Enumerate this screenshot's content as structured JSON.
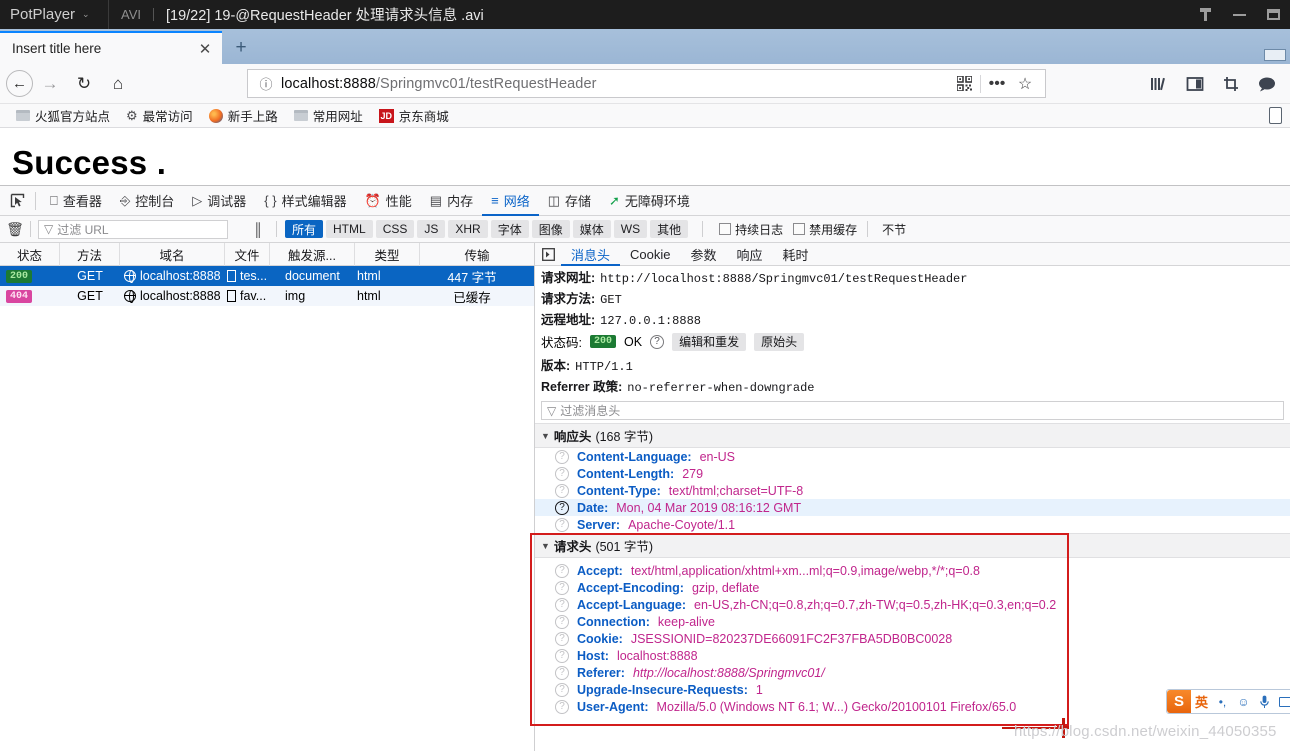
{
  "potplayer": {
    "app_name": "PotPlayer",
    "caret": "⌄",
    "format": "AVI",
    "title": "[19/22] 19-@RequestHeader 处理请求头信息 .avi",
    "pin_icon": "pin-icon",
    "minimize_icon": "minimize-icon",
    "maximize_icon": "maximize-icon"
  },
  "browser": {
    "tab_title": "Insert title here",
    "tab_close": "✕",
    "new_tab": "+",
    "nav": {
      "back": "←",
      "forward": "→",
      "reload": "↻",
      "home": "⌂"
    },
    "url": {
      "info_icon": "ⓘ",
      "full": "localhost:8888/Springmvc01/testRequestHeader",
      "host": "localhost:8888",
      "path": "/Springmvc01/testRequestHeader",
      "qr_icon": "qr-code-icon",
      "more_icon": "•••",
      "star_icon": "☆"
    },
    "toolbar_icons": [
      "library-icon",
      "sidebar-icon",
      "screenshot-icon",
      "pocket-icon"
    ],
    "bookmarks": [
      {
        "label": "火狐官方站点",
        "icon": "folder-icon"
      },
      {
        "label": "最常访问",
        "icon": "gear-icon"
      },
      {
        "label": "新手上路",
        "icon": "firefox-icon"
      },
      {
        "label": "常用网址",
        "icon": "folder-icon"
      },
      {
        "label": "京东商城",
        "icon": "jd-icon"
      }
    ]
  },
  "page": {
    "heading": "Success ."
  },
  "devtools": {
    "picker_icon": "element-picker-icon",
    "tabs": [
      {
        "label": "查看器",
        "icon": "inspector-icon",
        "active": false
      },
      {
        "label": "控制台",
        "icon": "console-icon",
        "active": false
      },
      {
        "label": "调试器",
        "icon": "debugger-icon",
        "active": false
      },
      {
        "label": "样式编辑器",
        "icon": "style-editor-icon",
        "active": false
      },
      {
        "label": "性能",
        "icon": "performance-icon",
        "active": false
      },
      {
        "label": "内存",
        "icon": "memory-icon",
        "active": false
      },
      {
        "label": "网络",
        "icon": "network-icon",
        "active": true
      },
      {
        "label": "存储",
        "icon": "storage-icon",
        "active": false
      },
      {
        "label": "无障碍环境",
        "icon": "accessibility-icon",
        "active": false
      }
    ],
    "toolbar": {
      "trash_icon": "trash-icon",
      "filter_placeholder": "过滤 URL",
      "filter_icon": "funnel-icon",
      "pause_icon": "pause-icon",
      "type_filters": [
        {
          "label": "所有",
          "active": true
        },
        {
          "label": "HTML",
          "active": false
        },
        {
          "label": "CSS",
          "active": false
        },
        {
          "label": "JS",
          "active": false
        },
        {
          "label": "XHR",
          "active": false
        },
        {
          "label": "字体",
          "active": false
        },
        {
          "label": "图像",
          "active": false
        },
        {
          "label": "媒体",
          "active": false
        },
        {
          "label": "WS",
          "active": false
        },
        {
          "label": "其他",
          "active": false
        }
      ],
      "checkboxes": [
        {
          "label": "持续日志",
          "checked": false
        },
        {
          "label": "禁用缓存",
          "checked": false
        }
      ],
      "trailing_label": "不节"
    },
    "request_list": {
      "columns": [
        "状态",
        "方法",
        "域名",
        "文件",
        "触发源...",
        "类型",
        "传输"
      ],
      "rows": [
        {
          "status": "200",
          "method": "GET",
          "domain": "localhost:8888",
          "file": "tes...",
          "cause": "document",
          "type": "html",
          "transferred": "447 字节",
          "selected": true,
          "file_icon": "document-icon"
        },
        {
          "status": "404",
          "method": "GET",
          "domain": "localhost:8888",
          "file": "fav...",
          "cause": "img",
          "type": "html",
          "transferred": "已缓存",
          "selected": false,
          "file_icon": "file-icon"
        }
      ]
    },
    "detail": {
      "toggle_icon": "panel-toggle-icon",
      "tabs": [
        {
          "label": "消息头",
          "active": true
        },
        {
          "label": "Cookie",
          "active": false
        },
        {
          "label": "参数",
          "active": false
        },
        {
          "label": "响应",
          "active": false
        },
        {
          "label": "耗时",
          "active": false
        }
      ],
      "summary": [
        {
          "key": "请求网址:",
          "value": "http://localhost:8888/Springmvc01/testRequestHeader"
        },
        {
          "key": "请求方法:",
          "value": "GET"
        },
        {
          "key": "远程地址:",
          "value": "127.0.0.1:8888"
        }
      ],
      "status": {
        "key": "状态码:",
        "code": "200",
        "text": "OK",
        "help_icon": "help-icon",
        "edit_resend_button": "编辑和重发",
        "raw_headers_button": "原始头"
      },
      "version": {
        "key": "版本:",
        "value": "HTTP/1.1"
      },
      "referrer_policy": {
        "key": "Referrer 政策:",
        "value": "no-referrer-when-downgrade"
      },
      "header_filter_placeholder": "过滤消息头",
      "response_section": {
        "title": "响应头",
        "size": "(168 字节)",
        "headers": [
          {
            "name": "Content-Language:",
            "value": "en-US",
            "highlight": false
          },
          {
            "name": "Content-Length:",
            "value": "279",
            "highlight": false
          },
          {
            "name": "Content-Type:",
            "value": "text/html;charset=UTF-8",
            "highlight": false
          },
          {
            "name": "Date:",
            "value": "Mon, 04 Mar 2019 08:16:12 GMT",
            "highlight": true
          },
          {
            "name": "Server:",
            "value": "Apache-Coyote/1.1",
            "highlight": false
          }
        ]
      },
      "request_section": {
        "title": "请求头",
        "size": "(501 字节)",
        "headers": [
          {
            "name": "Accept:",
            "value": "text/html,application/xhtml+xm...ml;q=0.9,image/webp,*/*;q=0.8",
            "italic": false
          },
          {
            "name": "Accept-Encoding:",
            "value": "gzip, deflate",
            "italic": false
          },
          {
            "name": "Accept-Language:",
            "value": "en-US,zh-CN;q=0.8,zh;q=0.7,zh-TW;q=0.5,zh-HK;q=0.3,en;q=0.2",
            "italic": false
          },
          {
            "name": "Connection:",
            "value": "keep-alive",
            "italic": false
          },
          {
            "name": "Cookie:",
            "value": "JSESSIONID=820237DE66091FC2F37FBA5DB0BC0028",
            "italic": false
          },
          {
            "name": "Host:",
            "value": "localhost:8888",
            "italic": false
          },
          {
            "name": "Referer:",
            "value": "http://localhost:8888/Springmvc01/",
            "italic": true
          },
          {
            "name": "Upgrade-Insecure-Requests:",
            "value": "1",
            "italic": false
          },
          {
            "name": "User-Agent:",
            "value": "Mozilla/5.0 (Windows NT 6.1; W...) Gecko/20100101 Firefox/65.0",
            "italic": false
          }
        ]
      }
    }
  },
  "ime": {
    "logo": "S",
    "mode": "英",
    "punctuation": "•,",
    "emoji": "☺",
    "mic": "🎙",
    "keyboard": "keyboard-icon"
  },
  "watermark": "https://blog.csdn.net/weixin_44050355",
  "colors": {
    "accent_blue": "#0a65c2",
    "status_200": "#1c7a33",
    "status_404": "#d946a0",
    "annotation_red": "#d31c1c",
    "header_name": "#0b5cc4",
    "header_value": "#c0258c"
  }
}
